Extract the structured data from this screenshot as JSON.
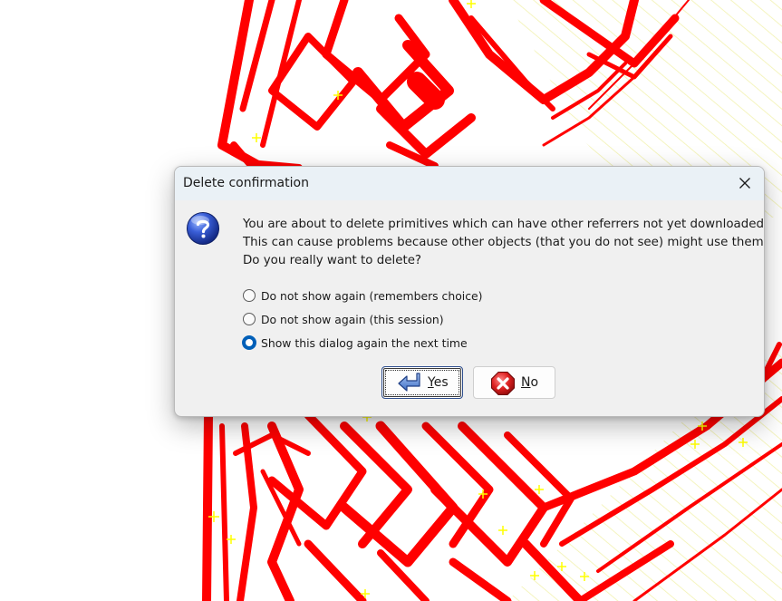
{
  "background": {
    "description_icon": "map-canvas",
    "colors": {
      "way": "#ff0000",
      "node_marker": "#ffff00",
      "area_hatch": "#f2f2b0",
      "background": "#ffffff"
    }
  },
  "dialog": {
    "title": "Delete confirmation",
    "close_icon": "close-icon",
    "icon": "question-icon",
    "message_lines": [
      "You are about to delete primitives which can have other referrers not yet downloaded.",
      "This can cause problems because other objects (that you do not see) might use them.",
      "Do you really want to delete?"
    ],
    "options": [
      {
        "label": "Do not show again (remembers choice)",
        "checked": false
      },
      {
        "label": "Do not show again (this session)",
        "checked": false
      },
      {
        "label": "Show this dialog again the next time",
        "checked": true
      }
    ],
    "buttons": {
      "yes": {
        "mnemonic": "Y",
        "rest": "es",
        "icon": "yes-arrow-icon"
      },
      "no": {
        "mnemonic": "N",
        "rest": "o",
        "icon": "no-cancel-icon"
      }
    },
    "colors": {
      "accent": "#005fb8",
      "titlebar": "#eaf1f6",
      "body": "#f0f0f0"
    }
  }
}
